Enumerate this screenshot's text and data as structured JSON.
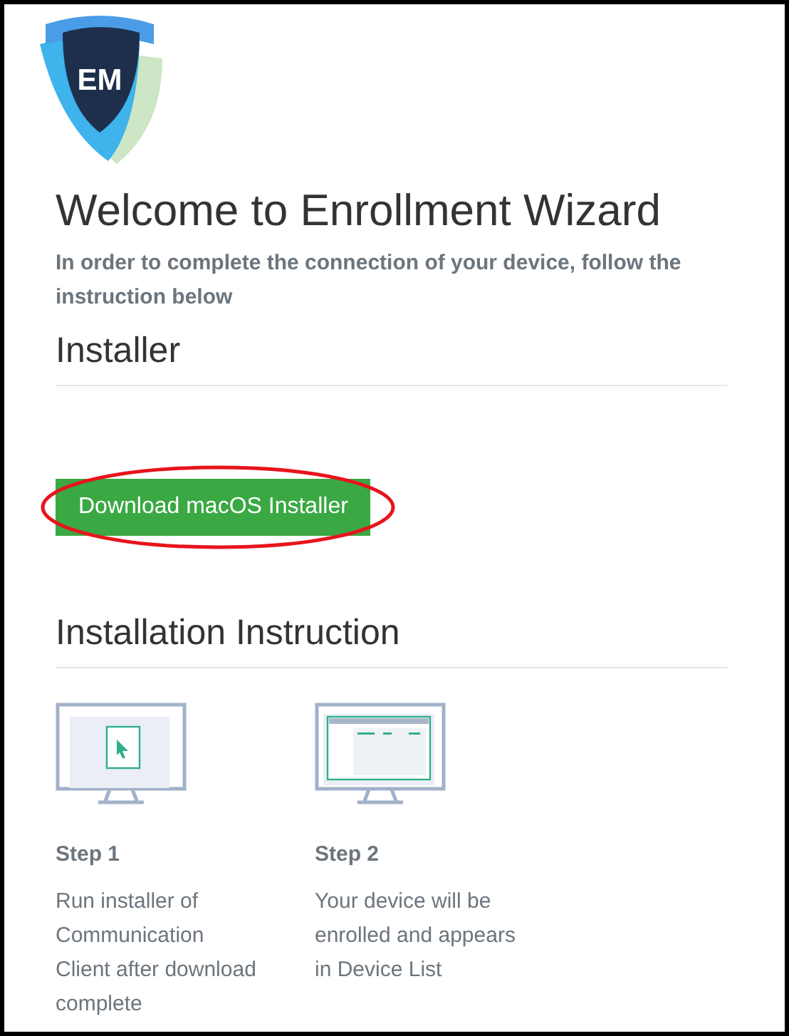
{
  "logo": {
    "text": "EM"
  },
  "title": "Welcome to Enrollment Wizard",
  "subtitle": "In order to complete the connection of your device, follow the instruction below",
  "installer": {
    "heading": "Installer",
    "button": "Download macOS Installer",
    "highlighted": true
  },
  "instructions": {
    "heading": "Installation Instruction",
    "steps": [
      {
        "kind": "file",
        "title": "Step 1",
        "text": "Run installer of Communication Client after download complete"
      },
      {
        "kind": "list",
        "title": "Step 2",
        "text": "Your device will be enrolled and appears in Device List"
      }
    ]
  }
}
